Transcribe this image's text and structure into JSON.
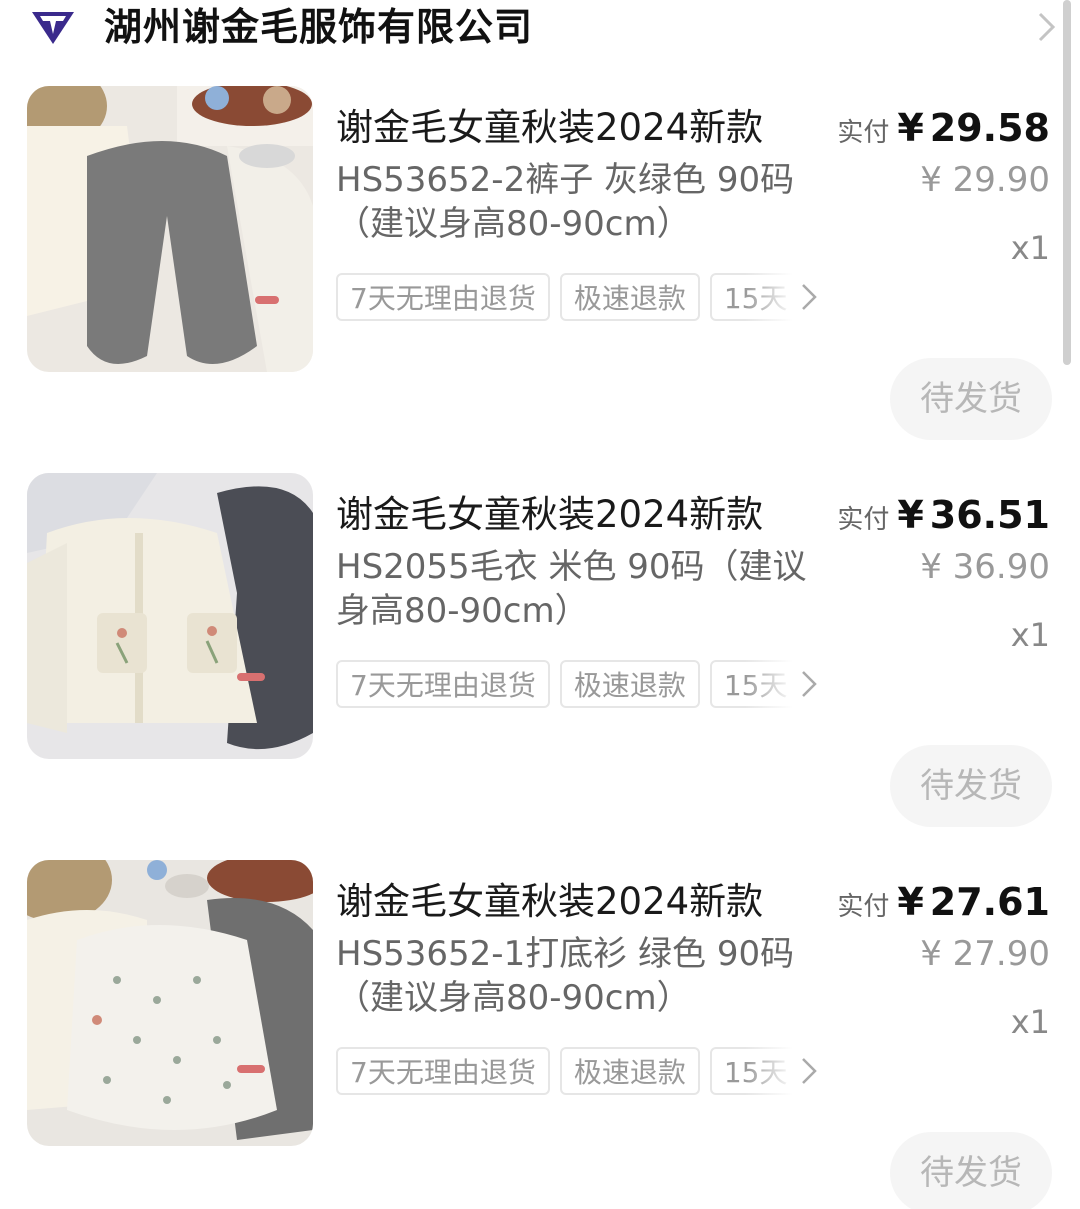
{
  "store": {
    "name": "湖州谢金毛服饰有限公司",
    "logo_icon": "diamond-t-logo-icon",
    "chevron_icon": "chevron-right-icon"
  },
  "items": [
    {
      "title": "谢金毛女童秋装2024新款",
      "spec": "HS53652-2裤子 灰绿色 90码（建议身高80-90cm）",
      "tags": [
        "7天无理由退货",
        "极速退款",
        "15天"
      ],
      "paid_label": "实付",
      "currency": "¥",
      "paid": "29.58",
      "original": "¥ 29.90",
      "quantity": "x1",
      "status": "待发货"
    },
    {
      "title": "谢金毛女童秋装2024新款",
      "spec": "HS2055毛衣 米色 90码（建议身高80-90cm）",
      "tags": [
        "7天无理由退货",
        "极速退款",
        "15天"
      ],
      "paid_label": "实付",
      "currency": "¥",
      "paid": "36.51",
      "original": "¥ 36.90",
      "quantity": "x1",
      "status": "待发货"
    },
    {
      "title": "谢金毛女童秋装2024新款",
      "spec": "HS53652-1打底衫 绿色 90码（建议身高80-90cm）",
      "tags": [
        "7天无理由退货",
        "极速退款",
        "15天"
      ],
      "paid_label": "实付",
      "currency": "¥",
      "paid": "27.61",
      "original": "¥ 27.90",
      "quantity": "x1",
      "status": "待发货"
    }
  ],
  "colors": {
    "logo": "#3a2a8c",
    "text_primary": "#111111",
    "text_secondary": "#666666",
    "text_muted": "#999999",
    "status_bg": "#f5f5f5"
  }
}
